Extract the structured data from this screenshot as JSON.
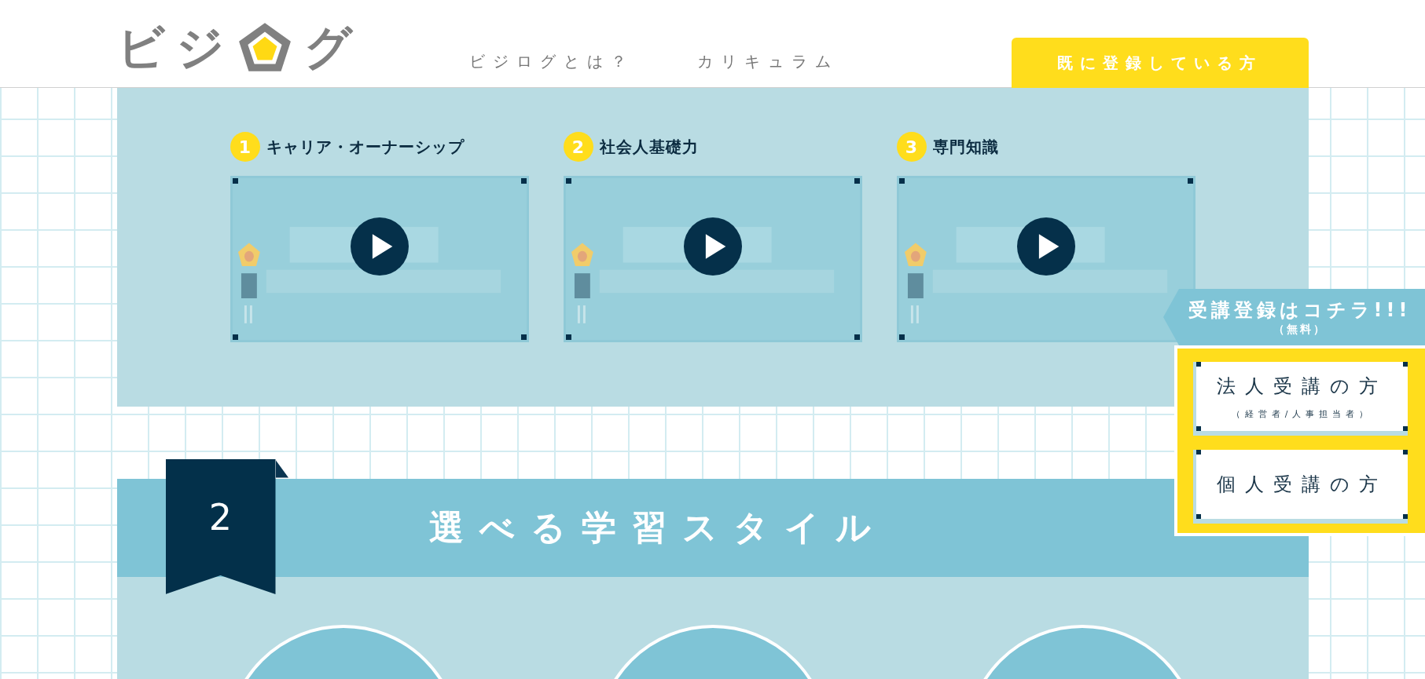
{
  "header": {
    "logo": {
      "before": "ビジ",
      "after": "グ"
    },
    "nav": [
      {
        "label": "ビジログとは？"
      },
      {
        "label": "カリキュラム"
      }
    ],
    "login_button": "既に登録している方"
  },
  "videos": [
    {
      "number": "1",
      "title": "キャリア・オーナーシップ"
    },
    {
      "number": "2",
      "title": "社会人基礎力"
    },
    {
      "number": "3",
      "title": "専門知識"
    }
  ],
  "section": {
    "number": "2",
    "title": "選べる学習スタイル"
  },
  "signup_panel": {
    "title": "受講登録はコチラ!!!",
    "note": "（無料）",
    "buttons": [
      {
        "label": "法人受講の方",
        "sub": "（経営者/人事担当者）"
      },
      {
        "label": "個人受講の方"
      }
    ]
  }
}
